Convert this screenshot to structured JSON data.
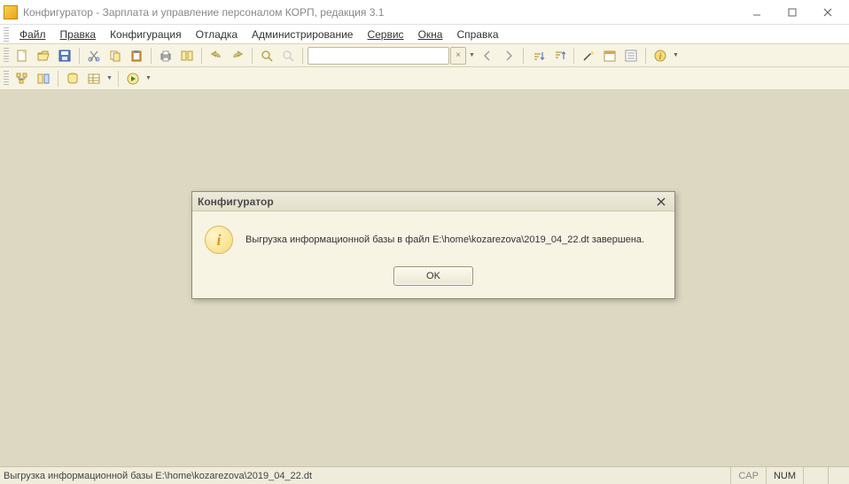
{
  "window": {
    "title": "Конфигуратор - Зарплата и управление персоналом КОРП, редакция 3.1"
  },
  "menu": {
    "file": "Файл",
    "edit": "Правка",
    "config": "Конфигурация",
    "debug": "Отладка",
    "admin": "Администрирование",
    "service": "Сервис",
    "windows": "Окна",
    "help": "Справка"
  },
  "search": {
    "placeholder": ""
  },
  "dialog": {
    "title": "Конфигуратор",
    "message": "Выгрузка информационной базы в файл E:\\home\\kozarezova\\2019_04_22.dt завершена.",
    "ok": "OK"
  },
  "status": {
    "message": "Выгрузка информационной базы E:\\home\\kozarezova\\2019_04_22.dt",
    "cap": "CAP",
    "num": "NUM"
  }
}
